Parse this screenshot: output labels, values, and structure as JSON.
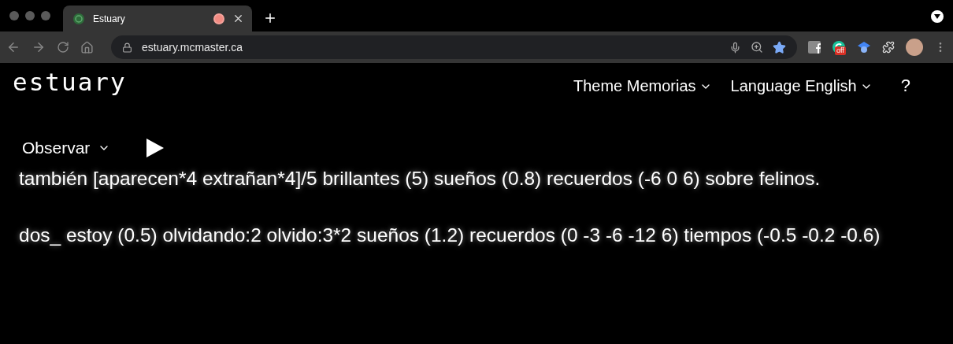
{
  "browser": {
    "tab": {
      "title": "Estuary",
      "recording": true
    },
    "url": "estuary.mcmaster.ca",
    "bookmarked": true,
    "extension_badge": "off"
  },
  "header": {
    "logo": "estuary",
    "menus": [
      {
        "label": "Theme",
        "value": "Memorias"
      },
      {
        "label": "Language",
        "value": "English"
      }
    ],
    "help": "?"
  },
  "mode": {
    "label": "Observar"
  },
  "code_lines": [
    "también [aparecen*4 extrañan*4]/5 brillantes (5) sueños (0.8) recuerdos (-6 0 6) sobre felinos.",
    "dos_ estoy (0.5) olvidando:2 olvido:3*2 sueños (1.2) recuerdos (0 -3 -6 -12 6) tiempos (-0.5 -0.2 -0.6)"
  ]
}
